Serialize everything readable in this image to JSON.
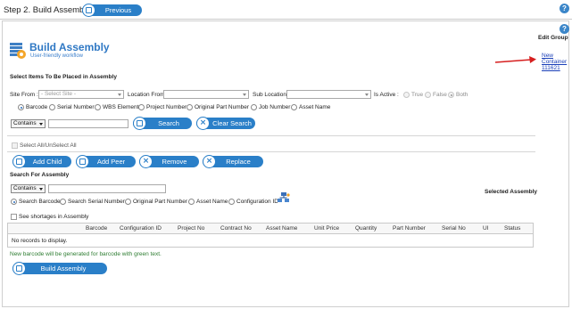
{
  "header": {
    "step_title": "Step 2. Build Assembly",
    "previous_label": "Previous",
    "help_glyph": "?"
  },
  "logo": {
    "title": "Build Assembly",
    "subtitle": "User-friendly workflow"
  },
  "edit_group": {
    "label": "Edit Group",
    "new_container_link": [
      "New",
      "Container",
      "111621"
    ],
    "arrow_color": "#d61f1f"
  },
  "select_section": {
    "heading": "Select Items To Be Placed in Assembly",
    "site_from_label": "Site From :",
    "site_from_value": "- Select Site -",
    "location_from_label": "Location From",
    "sub_location_label": "Sub Location",
    "is_active_label": "Is Active :",
    "is_active_options": [
      "True",
      "False",
      "Both"
    ],
    "is_active_selected": "Both",
    "search_type_options": [
      "Barcode",
      "Serial Number",
      "WBS Element",
      "Project Number",
      "Original Part Number",
      "Job Number",
      "Asset Name"
    ],
    "search_type_selected": "Barcode",
    "match_mode": "Contains",
    "search_value": "",
    "search_button": "Search",
    "clear_search_button": "Clear Search",
    "select_all_label": "Select All/UnSelect All"
  },
  "action_buttons": {
    "add_child": "Add Child",
    "add_peer": "Add Peer",
    "remove": "Remove",
    "replace": "Replace"
  },
  "assembly_search": {
    "heading": "Search For Assembly",
    "match_mode": "Contains",
    "search_value": "",
    "search_type_options": [
      "Search Barcode",
      "Search Serial Number",
      "Original Part Number",
      "Asset Name",
      "Configuration ID"
    ],
    "search_type_selected": "Search Barcode",
    "selected_assembly_label": "Selected Assembly",
    "shortages_label": "See shortages in Assembly"
  },
  "assembly_table": {
    "columns": [
      "Barcode",
      "Configuration ID",
      "Project No",
      "Contract No",
      "Asset Name",
      "Unit Price",
      "Quantity",
      "Part Number",
      "Serial No",
      "UI",
      "Status"
    ],
    "empty_text": "No records to display."
  },
  "footer": {
    "note": "New barcode will be generated for barcode with green text.",
    "build_button": "Build Assembly",
    "accent_color": "#2a7fc8",
    "note_color": "#2e7d32"
  },
  "icons": {
    "previous": "save-icon",
    "search": "save-icon",
    "clear": "close-icon",
    "add_child": "save-icon",
    "add_peer": "save-icon",
    "remove": "close-icon",
    "replace": "close-icon",
    "build": "save-icon",
    "config_lookup": "hierarchy-icon",
    "logo": "assembly-logo"
  }
}
